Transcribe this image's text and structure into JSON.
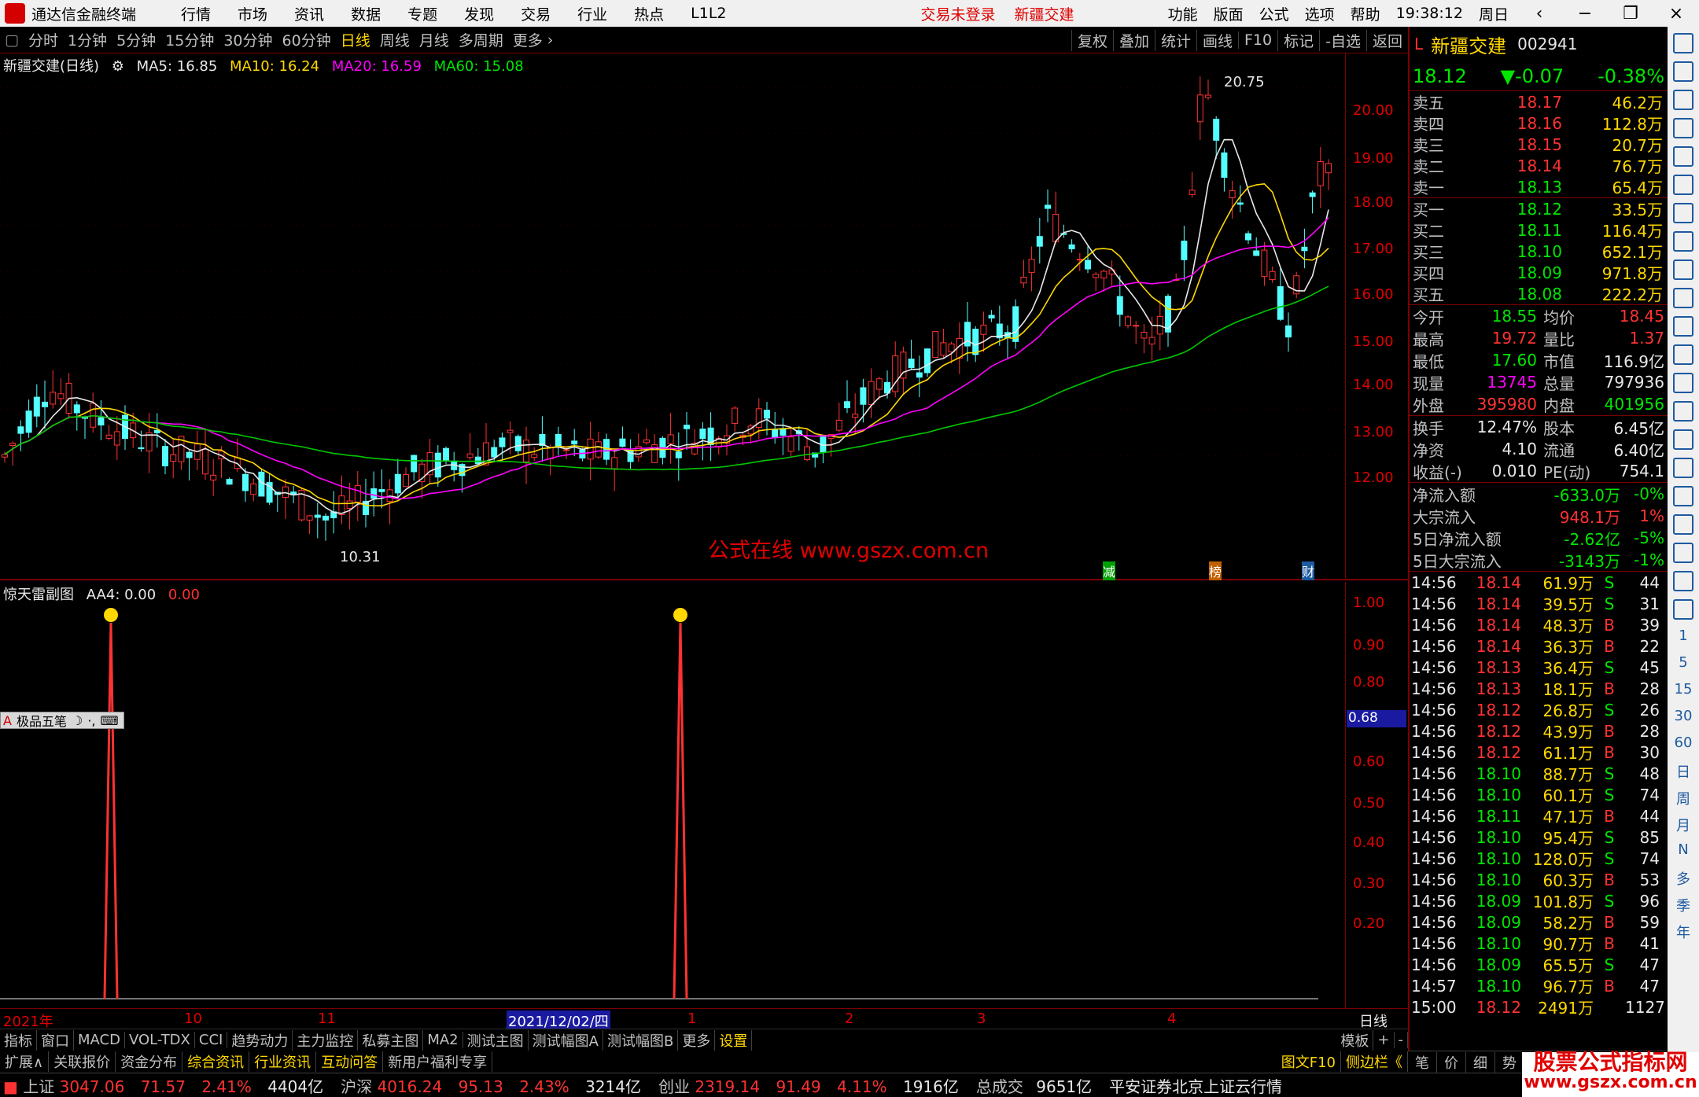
{
  "menubar": {
    "app_name": "通达信金融终端",
    "menus": [
      "行情",
      "市场",
      "资讯",
      "数据",
      "专题",
      "发现",
      "交易",
      "行业",
      "热点",
      "L1L2"
    ],
    "trade_status": "交易未登录",
    "stock_name": "新疆交建",
    "right_menus": [
      "功能",
      "版面",
      "公式",
      "选项",
      "帮助"
    ],
    "clock": "19:38:12",
    "weekday": "周日"
  },
  "periodbar": {
    "periods": [
      "分时",
      "1分钟",
      "5分钟",
      "15分钟",
      "30分钟",
      "60分钟",
      "日线",
      "周线",
      "月线",
      "多周期",
      "更多"
    ],
    "active": "日线",
    "tools": [
      "复权",
      "叠加",
      "统计",
      "画线",
      "F10",
      "标记",
      "-自选",
      "返回"
    ]
  },
  "main_chart": {
    "legend_title": "新疆交建(日线)",
    "ma5": "MA5: 16.85",
    "ma10": "MA10: 16.24",
    "ma20": "MA20: 16.59",
    "ma60": "MA60: 15.08",
    "high_label": "20.75",
    "low_label": "10.31",
    "y_ticks": [
      "20.00",
      "19.00",
      "18.00",
      "17.00",
      "16.00",
      "15.00",
      "14.00",
      "13.00",
      "12.00"
    ],
    "watermark": "公式在线  www.gszx.com.cn",
    "markers": [
      "减",
      "榜",
      "财"
    ]
  },
  "sub_chart": {
    "legend_title": "惊天雷副图",
    "aa4_label": "AA4: 0.00",
    "aa4_value": "0.00",
    "y_ticks": [
      "1.00",
      "0.90",
      "0.80",
      "0.60",
      "0.50",
      "0.40",
      "0.30",
      "0.20"
    ],
    "current_value": "0.68",
    "pen_toolbar": "极品五笔"
  },
  "xaxis": {
    "labels": [
      "2021年",
      "10",
      "11",
      "2021/12/02/四",
      "1",
      "2",
      "3",
      "4"
    ],
    "period": "日线"
  },
  "tabs_row1": [
    "指标",
    "窗口",
    "MACD",
    "VOL-TDX",
    "CCI",
    "趋势动力",
    "主力监控",
    "私募主图",
    "MA2",
    "测试主图",
    "测试幅图A",
    "测试幅图B",
    "更多",
    "设置"
  ],
  "tabs_row1_right": [
    "模板",
    "+",
    "-"
  ],
  "tabs_row2": [
    "扩展∧",
    "关联报价",
    "资金分布",
    "综合资讯",
    "行业资讯",
    "互动问答",
    "新用户福利专享"
  ],
  "tabs_row2_right": [
    "图文F10",
    "侧边栏《"
  ],
  "quote_panel": {
    "name": "新疆交建",
    "code": "002941",
    "price": "18.12",
    "change": "▼-0.07",
    "change_pct": "-0.38%",
    "asks": [
      {
        "label": "卖五",
        "price": "18.17",
        "vol": "46.2万"
      },
      {
        "label": "卖四",
        "price": "18.16",
        "vol": "112.8万"
      },
      {
        "label": "卖三",
        "price": "18.15",
        "vol": "20.7万"
      },
      {
        "label": "卖二",
        "price": "18.14",
        "vol": "76.7万"
      },
      {
        "label": "卖一",
        "price": "18.13",
        "vol": "65.4万"
      }
    ],
    "bids": [
      {
        "label": "买一",
        "price": "18.12",
        "vol": "33.5万"
      },
      {
        "label": "买二",
        "price": "18.11",
        "vol": "116.4万"
      },
      {
        "label": "买三",
        "price": "18.10",
        "vol": "652.1万"
      },
      {
        "label": "买四",
        "price": "18.09",
        "vol": "971.8万"
      },
      {
        "label": "买五",
        "price": "18.08",
        "vol": "222.2万"
      }
    ],
    "stats": [
      {
        "k": "今开",
        "v": "18.55",
        "k2": "均价",
        "v2": "18.45"
      },
      {
        "k": "最高",
        "v": "19.72",
        "k2": "量比",
        "v2": "1.37"
      },
      {
        "k": "最低",
        "v": "17.60",
        "k2": "市值",
        "v2": "116.9亿"
      },
      {
        "k": "现量",
        "v": "13745",
        "k2": "总量",
        "v2": "797936"
      },
      {
        "k": "外盘",
        "v": "395980",
        "k2": "内盘",
        "v2": "401956"
      }
    ],
    "stats2": [
      {
        "k": "换手",
        "v": "12.47%",
        "k2": "股本",
        "v2": "6.45亿"
      },
      {
        "k": "净资",
        "v": "4.10",
        "k2": "流通",
        "v2": "6.40亿"
      },
      {
        "k": "收益(-)",
        "v": "0.010",
        "k2": "PE(动)",
        "v2": "754.1"
      }
    ],
    "flows": [
      {
        "k": "净流入额",
        "v": "-633.0万",
        "pc": "-0%"
      },
      {
        "k": "大宗流入",
        "v": "948.1万",
        "pc": "1%"
      },
      {
        "k": "5日净流入额",
        "v": "-2.62亿",
        "pc": "-5%"
      },
      {
        "k": "5日大宗流入",
        "v": "-3143万",
        "pc": "-1%"
      }
    ],
    "ticks": [
      {
        "t": "14:56",
        "p": "18.14",
        "v": "61.9万",
        "bs": "S",
        "n": "44"
      },
      {
        "t": "14:56",
        "p": "18.14",
        "v": "39.5万",
        "bs": "S",
        "n": "31"
      },
      {
        "t": "14:56",
        "p": "18.14",
        "v": "48.3万",
        "bs": "B",
        "n": "39"
      },
      {
        "t": "14:56",
        "p": "18.14",
        "v": "36.3万",
        "bs": "B",
        "n": "22"
      },
      {
        "t": "14:56",
        "p": "18.13",
        "v": "36.4万",
        "bs": "S",
        "n": "45"
      },
      {
        "t": "14:56",
        "p": "18.13",
        "v": "18.1万",
        "bs": "B",
        "n": "28"
      },
      {
        "t": "14:56",
        "p": "18.12",
        "v": "26.8万",
        "bs": "S",
        "n": "26"
      },
      {
        "t": "14:56",
        "p": "18.12",
        "v": "43.9万",
        "bs": "B",
        "n": "28"
      },
      {
        "t": "14:56",
        "p": "18.12",
        "v": "61.1万",
        "bs": "B",
        "n": "30"
      },
      {
        "t": "14:56",
        "p": "18.10",
        "v": "88.7万",
        "bs": "S",
        "n": "48"
      },
      {
        "t": "14:56",
        "p": "18.10",
        "v": "60.1万",
        "bs": "S",
        "n": "74"
      },
      {
        "t": "14:56",
        "p": "18.11",
        "v": "47.1万",
        "bs": "B",
        "n": "44"
      },
      {
        "t": "14:56",
        "p": "18.10",
        "v": "95.4万",
        "bs": "S",
        "n": "85"
      },
      {
        "t": "14:56",
        "p": "18.10",
        "v": "128.0万",
        "bs": "S",
        "n": "74"
      },
      {
        "t": "14:56",
        "p": "18.10",
        "v": "60.3万",
        "bs": "B",
        "n": "53"
      },
      {
        "t": "14:56",
        "p": "18.09",
        "v": "101.8万",
        "bs": "S",
        "n": "96"
      },
      {
        "t": "14:56",
        "p": "18.09",
        "v": "58.2万",
        "bs": "B",
        "n": "59"
      },
      {
        "t": "14:56",
        "p": "18.10",
        "v": "90.7万",
        "bs": "B",
        "n": "41"
      },
      {
        "t": "14:56",
        "p": "18.09",
        "v": "65.5万",
        "bs": "S",
        "n": "47"
      },
      {
        "t": "14:57",
        "p": "18.10",
        "v": "96.7万",
        "bs": "B",
        "n": "47"
      },
      {
        "t": "15:00",
        "p": "18.12",
        "v": "2491万",
        "bs": "",
        "n": "1127"
      }
    ],
    "bottom_tabs": [
      "笔",
      "价",
      "细",
      "势"
    ]
  },
  "right_strip": [
    "日",
    "周",
    "月",
    "N",
    "多",
    "季",
    "年"
  ],
  "indexbar": {
    "items": [
      {
        "name": "上证",
        "val": "3047.06",
        "chg": "71.57",
        "pct": "2.41%",
        "amt": "4404亿"
      },
      {
        "name": "沪深",
        "val": "4016.24",
        "chg": "95.13",
        "pct": "2.43%",
        "amt": "3214亿"
      },
      {
        "name": "创业",
        "val": "2319.14",
        "chg": "91.49",
        "pct": "4.11%",
        "amt": "1916亿"
      }
    ],
    "total_label": "总成交",
    "total": "9651亿",
    "server": "平安证券北京上证云行情"
  },
  "brand": {
    "line1": "股票公式指标网",
    "line2": "www.gszx.com.cn"
  },
  "colors": {
    "up": "#ff3232",
    "down": "#00e600",
    "accent": "#ffd800",
    "ma10": "#ffd800",
    "ma20": "#ff00ff",
    "ma60": "#00c800",
    "frame": "#7a0000"
  }
}
